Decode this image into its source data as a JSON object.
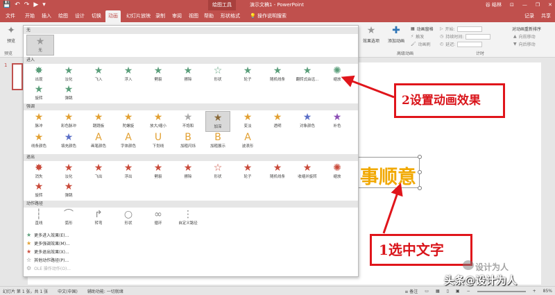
{
  "titlebar": {
    "qat_icons": [
      "save-icon",
      "undo-icon",
      "redo-icon",
      "start-icon",
      "customize-icon"
    ],
    "qat_glyphs": [
      "💾",
      "↶",
      "↷",
      "▶",
      "▾"
    ],
    "context_tab_title": "绘图工具",
    "doc_title": "演示文稿1 - PowerPoint",
    "user": "谷 结林",
    "controls": [
      "ribbon-options-icon",
      "minimize-icon",
      "restore-icon",
      "close-icon"
    ],
    "control_glyphs": [
      "⊡",
      "—",
      "❐",
      "✕"
    ]
  },
  "tabs": [
    {
      "label": "文件",
      "active": false
    },
    {
      "label": "开始",
      "active": false
    },
    {
      "label": "插入",
      "active": false
    },
    {
      "label": "绘图",
      "active": false
    },
    {
      "label": "设计",
      "active": false
    },
    {
      "label": "切换",
      "active": false
    },
    {
      "label": "动画",
      "active": true
    },
    {
      "label": "幻灯片放映",
      "active": false
    },
    {
      "label": "录制",
      "active": false
    },
    {
      "label": "审阅",
      "active": false
    },
    {
      "label": "视图",
      "active": false
    },
    {
      "label": "帮助",
      "active": false
    },
    {
      "label": "形状格式",
      "active": false
    },
    {
      "label": "操作说明搜索",
      "active": false
    }
  ],
  "tab_right": {
    "record": "记录",
    "share": "共享"
  },
  "ribbon": {
    "preview_label": "预览",
    "preview_group": "预览",
    "effect_options": "效果选项",
    "add_animation": "添加动画",
    "animation_pane": "动画窗格",
    "trigger": "触发",
    "animation_painter": "动画刷",
    "advanced_group": "高级动画",
    "start_label": "开始:",
    "duration_label": "持续时间:",
    "delay_label": "延迟:",
    "timing_group": "计时",
    "reorder_label": "对动画重新排序",
    "move_earlier": "向前移动",
    "move_later": "向后移动"
  },
  "thumbnail": {
    "number": "1"
  },
  "gallery": {
    "none_section": "无",
    "none_item": "无",
    "entrance_section": "进入",
    "entrance": [
      "出现",
      "淡化",
      "飞入",
      "浮入",
      "劈裂",
      "擦除",
      "形状",
      "轮子",
      "随机线条",
      "翻转式由远...",
      "缩放",
      "旋转",
      "弹跳"
    ],
    "emphasis_section": "强调",
    "emphasis": [
      "脉冲",
      "彩色脉冲",
      "跷跷板",
      "陀螺旋",
      "放大/缩小",
      "不饱和",
      "加深",
      "变淡",
      "透明",
      "对象颜色",
      "补色",
      "线条颜色",
      "填充颜色",
      "画笔颜色",
      "字体颜色",
      "下划线",
      "加粗闪烁",
      "加粗展示",
      "波浪形"
    ],
    "emphasis_selected": "加深",
    "exit_section": "退出",
    "exit": [
      "消失",
      "淡化",
      "飞出",
      "浮出",
      "劈裂",
      "擦除",
      "形状",
      "轮子",
      "随机线条",
      "收缩并旋转",
      "缩放",
      "旋转",
      "弹跳"
    ],
    "path_section": "动作路径",
    "path": [
      "直线",
      "弧形",
      "转弯",
      "形状",
      "循环",
      "自定义路径"
    ],
    "more": [
      {
        "label": "更多进入效果(E)...",
        "icon": "green-star-icon",
        "disabled": false
      },
      {
        "label": "更多强调效果(M)...",
        "icon": "yellow-star-icon",
        "disabled": false
      },
      {
        "label": "更多退出效果(X)...",
        "icon": "red-star-icon",
        "disabled": false
      },
      {
        "label": "其他动作路径(P)...",
        "icon": "outline-star-icon",
        "disabled": false
      },
      {
        "label": "OLE 操作动作(O)...",
        "icon": "ole-action-icon",
        "disabled": true
      }
    ]
  },
  "slide": {
    "text": "事顺意"
  },
  "annotations": {
    "step2": "2设置动画效果",
    "step1": "1选中文字"
  },
  "statusbar": {
    "slide_info": "幻灯片 第 1 张，共 1 张",
    "language": "中文(中国)",
    "accessibility": "辅助功能: 一切就绪",
    "notes": "备注",
    "zoom": "85%"
  },
  "watermark": {
    "line1": "设计为人",
    "line2": "头条@设计为人"
  },
  "colors": {
    "accent": "#c0504d",
    "entrance": "#5a9e7a",
    "emphasis": "#e2a032",
    "exit": "#c94a3a",
    "annotation_red": "#e0151b",
    "slide_text": "#f1a800"
  }
}
